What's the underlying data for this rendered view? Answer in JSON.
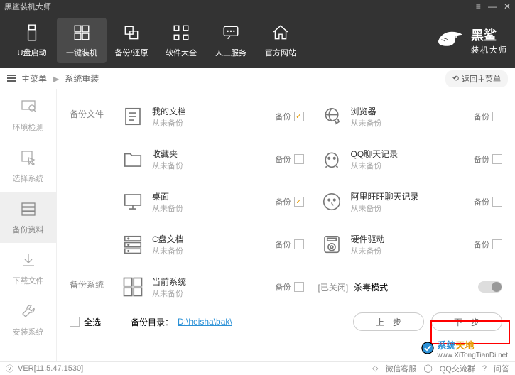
{
  "title": "黑鲨装机大师",
  "nav": [
    {
      "label": "U盘启动"
    },
    {
      "label": "一键装机"
    },
    {
      "label": "备份/还原"
    },
    {
      "label": "软件大全"
    },
    {
      "label": "人工服务"
    },
    {
      "label": "官方网站"
    }
  ],
  "brand": {
    "main": "黑鲨",
    "sub": "装机大师"
  },
  "breadcrumb": {
    "root": "主菜单",
    "current": "系统重装",
    "back": "返回主菜单"
  },
  "steps": [
    {
      "label": "环境检测"
    },
    {
      "label": "选择系统"
    },
    {
      "label": "备份资料"
    },
    {
      "label": "下载文件"
    },
    {
      "label": "安装系统"
    }
  ],
  "sections": {
    "files": "备份文件",
    "system": "备份系统"
  },
  "items_left": [
    {
      "title": "我的文档",
      "sub": "从未备份",
      "checked": true
    },
    {
      "title": "收藏夹",
      "sub": "从未备份",
      "checked": false
    },
    {
      "title": "桌面",
      "sub": "从未备份",
      "checked": true
    },
    {
      "title": "C盘文档",
      "sub": "从未备份",
      "checked": false
    }
  ],
  "items_right": [
    {
      "title": "浏览器",
      "sub": "从未备份",
      "checked": false
    },
    {
      "title": "QQ聊天记录",
      "sub": "从未备份",
      "checked": false
    },
    {
      "title": "阿里旺旺聊天记录",
      "sub": "从未备份",
      "checked": false
    },
    {
      "title": "硬件驱动",
      "sub": "从未备份",
      "checked": false
    }
  ],
  "system_item": {
    "title": "当前系统",
    "sub": "从未备份",
    "checked": false
  },
  "kill": {
    "off": "[已关闭]",
    "label": "杀毒模式"
  },
  "backup_word": "备份",
  "select_all": "全选",
  "path_label": "备份目录：",
  "path": "D:\\heisha\\bak\\",
  "btn_prev": "上一步",
  "btn_next": "下一步",
  "version": "VER[11.5.47.1530]",
  "status_right": [
    "微信客服",
    "QQ交流群",
    "问答"
  ],
  "watermark": {
    "t1": "系统",
    "t2": "天地",
    "url": "www.XiTongTianDi.net"
  }
}
